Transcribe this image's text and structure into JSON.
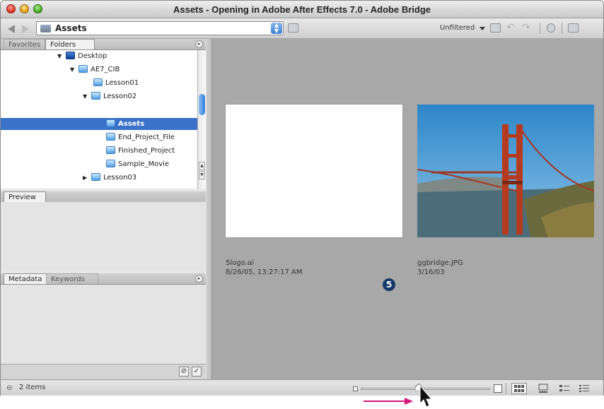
{
  "window": {
    "title": "Assets - Opening in Adobe After Effects 7.0 - Adobe Bridge"
  },
  "toolbar": {
    "path_label": "Assets",
    "filter_label": "Unfiltered"
  },
  "panels": {
    "tabs_top": [
      "Favorites",
      "Folders"
    ],
    "preview_tab": "Preview",
    "tabs_bottom": [
      "Metadata",
      "Keywords"
    ]
  },
  "folders": {
    "tree": [
      {
        "label": "Desktop",
        "expanded": true
      },
      {
        "label": "AE7_CIB",
        "expanded": true
      },
      {
        "label": "Lesson01"
      },
      {
        "label": "Lesson02",
        "expanded": true
      },
      {
        "label": "Assets",
        "selected": true
      },
      {
        "label": "End_Project_File"
      },
      {
        "label": "Finished_Project"
      },
      {
        "label": "Sample_Movie"
      },
      {
        "label": "Lesson03",
        "expanded": false
      }
    ]
  },
  "content": {
    "items": [
      {
        "name": "5logo.ai",
        "date": "8/26/05, 13:27:17 AM",
        "logo_glyph": "5"
      },
      {
        "name": "ggbridge.JPG",
        "date": "3/16/03"
      }
    ]
  },
  "status": {
    "count_text": "2 items",
    "thumbnail_zoom_fraction": 0.45
  },
  "colors": {
    "selection": "#3a71c9",
    "content_bg": "#a8a8a8",
    "annotation_arrow": "#d4187a"
  }
}
